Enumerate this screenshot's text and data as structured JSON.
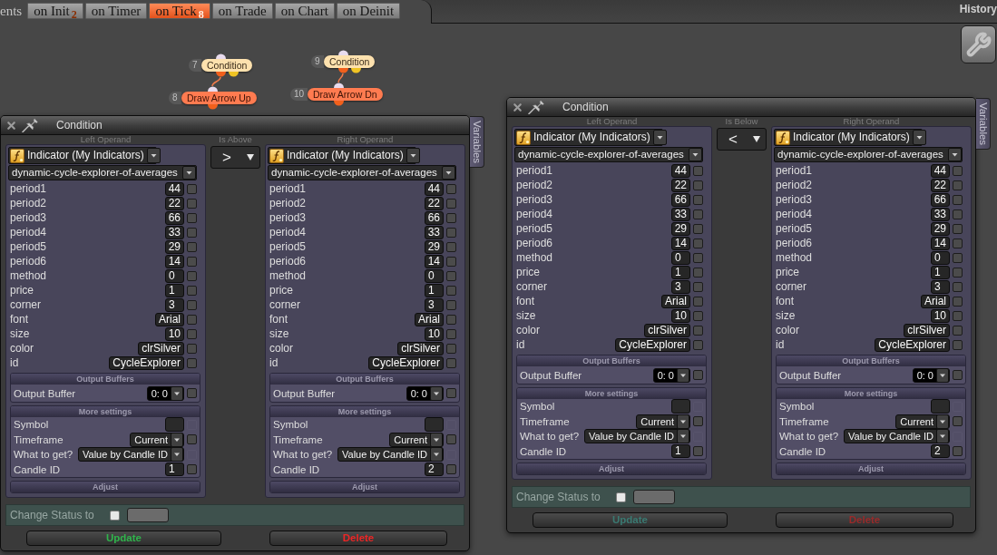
{
  "top_bar": {
    "partial_label": "ents",
    "tabs": [
      {
        "label": "on Init",
        "count": "2",
        "selected": false
      },
      {
        "label": "on Timer",
        "selected": false
      },
      {
        "label": "on Tick",
        "count": "8",
        "selected": true
      },
      {
        "label": "on Trade",
        "selected": false
      },
      {
        "label": "on Chart",
        "selected": false
      },
      {
        "label": "on Deinit",
        "selected": false
      }
    ],
    "history_label": "History"
  },
  "canvas": {
    "nodes": [
      {
        "number": "7",
        "label": "Condition",
        "kind": "condition",
        "children": [
          {
            "number": "8",
            "label": "Draw Arrow Up",
            "kind": "action"
          }
        ]
      },
      {
        "number": "9",
        "label": "Condition",
        "kind": "condition",
        "children": [
          {
            "number": "10",
            "label": "Draw Arrow Dn",
            "kind": "action"
          }
        ]
      }
    ]
  },
  "windows": [
    {
      "title": "Condition",
      "focused": true,
      "left_operand": {
        "heading": "Left Operand",
        "source": "Indicator (My Indicators)",
        "indicator": "dynamic-cycle-explorer-of-averages",
        "params": [
          {
            "name": "period1",
            "value": "44",
            "checked": false
          },
          {
            "name": "period2",
            "value": "22",
            "checked": false
          },
          {
            "name": "period3",
            "value": "66",
            "checked": false
          },
          {
            "name": "period4",
            "value": "33",
            "checked": false
          },
          {
            "name": "period5",
            "value": "29",
            "checked": false
          },
          {
            "name": "period6",
            "value": "14",
            "checked": false
          },
          {
            "name": "method",
            "value": "0",
            "checked": false
          },
          {
            "name": "price",
            "value": "1",
            "checked": false
          },
          {
            "name": "corner",
            "value": "3",
            "checked": false
          },
          {
            "name": "font",
            "value": "Arial",
            "checked": false
          },
          {
            "name": "size",
            "value": "10",
            "checked": false
          },
          {
            "name": "color",
            "value": "clrSilver",
            "checked": false
          },
          {
            "name": "id",
            "value": "CycleExplorer",
            "checked": false
          }
        ],
        "output_buffers": {
          "heading": "Output Buffers",
          "rows": [
            {
              "name": "Output Buffer",
              "value": "0: 0",
              "checked": false
            }
          ]
        },
        "more_settings": {
          "heading": "More settings",
          "rows": [
            {
              "name": "Symbol",
              "kind": "field",
              "checked": false,
              "disabled": true
            },
            {
              "name": "Timeframe",
              "kind": "select",
              "value": "Current",
              "checked": false,
              "disabled": false
            },
            {
              "name": "What to get?",
              "kind": "select",
              "value": "Value by Candle ID",
              "checked": false,
              "disabled": true
            },
            {
              "name": "Candle ID",
              "kind": "field",
              "value": "1",
              "checked": false,
              "disabled": false
            }
          ]
        },
        "adjust": {
          "heading": "Adjust"
        }
      },
      "operator": {
        "label": "Is Above",
        "value": ">"
      },
      "right_operand": {
        "heading": "Right Operand",
        "source": "Indicator (My Indicators)",
        "indicator": "dynamic-cycle-explorer-of-averages",
        "params": [
          {
            "name": "period1",
            "value": "44",
            "checked": false
          },
          {
            "name": "period2",
            "value": "22",
            "checked": false
          },
          {
            "name": "period3",
            "value": "66",
            "checked": false
          },
          {
            "name": "period4",
            "value": "33",
            "checked": false
          },
          {
            "name": "period5",
            "value": "29",
            "checked": false
          },
          {
            "name": "period6",
            "value": "14",
            "checked": false
          },
          {
            "name": "method",
            "value": "0",
            "checked": false
          },
          {
            "name": "price",
            "value": "1",
            "checked": false
          },
          {
            "name": "corner",
            "value": "3",
            "checked": false
          },
          {
            "name": "font",
            "value": "Arial",
            "checked": false
          },
          {
            "name": "size",
            "value": "10",
            "checked": false
          },
          {
            "name": "color",
            "value": "clrSilver",
            "checked": false
          },
          {
            "name": "id",
            "value": "CycleExplorer",
            "checked": false
          }
        ],
        "output_buffers": {
          "heading": "Output Buffers",
          "rows": [
            {
              "name": "Output Buffer",
              "value": "0: 0",
              "checked": false
            }
          ]
        },
        "more_settings": {
          "heading": "More settings",
          "rows": [
            {
              "name": "Symbol",
              "kind": "field",
              "checked": false,
              "disabled": true
            },
            {
              "name": "Timeframe",
              "kind": "select",
              "value": "Current",
              "checked": false,
              "disabled": false
            },
            {
              "name": "What to get?",
              "kind": "select",
              "value": "Value by Candle ID",
              "checked": false,
              "disabled": true
            },
            {
              "name": "Candle ID",
              "kind": "field",
              "value": "2",
              "checked": false,
              "disabled": false
            }
          ]
        },
        "adjust": {
          "heading": "Adjust"
        }
      },
      "status": {
        "label": "Change Status to",
        "checked": false
      },
      "buttons": [
        {
          "label": "Update",
          "kind": "update"
        },
        {
          "label": "Delete",
          "kind": "delete"
        }
      ],
      "side_tab": "Variables"
    },
    {
      "title": "Condition",
      "focused": false,
      "left_operand": {
        "heading": "Left Operand",
        "source": "Indicator (My Indicators)",
        "indicator": "dynamic-cycle-explorer-of-averages",
        "params": [
          {
            "name": "period1",
            "value": "44",
            "checked": false
          },
          {
            "name": "period2",
            "value": "22",
            "checked": false
          },
          {
            "name": "period3",
            "value": "66",
            "checked": false
          },
          {
            "name": "period4",
            "value": "33",
            "checked": false
          },
          {
            "name": "period5",
            "value": "29",
            "checked": false
          },
          {
            "name": "period6",
            "value": "14",
            "checked": false
          },
          {
            "name": "method",
            "value": "0",
            "checked": false
          },
          {
            "name": "price",
            "value": "1",
            "checked": false
          },
          {
            "name": "corner",
            "value": "3",
            "checked": false
          },
          {
            "name": "font",
            "value": "Arial",
            "checked": false
          },
          {
            "name": "size",
            "value": "10",
            "checked": false
          },
          {
            "name": "color",
            "value": "clrSilver",
            "checked": false
          },
          {
            "name": "id",
            "value": "CycleExplorer",
            "checked": false
          }
        ],
        "output_buffers": {
          "heading": "Output Buffers",
          "rows": [
            {
              "name": "Output Buffer",
              "value": "0: 0",
              "checked": false
            }
          ]
        },
        "more_settings": {
          "heading": "More settings",
          "rows": [
            {
              "name": "Symbol",
              "kind": "field",
              "checked": false,
              "disabled": true
            },
            {
              "name": "Timeframe",
              "kind": "select",
              "value": "Current",
              "checked": false,
              "disabled": false
            },
            {
              "name": "What to get?",
              "kind": "select",
              "value": "Value by Candle ID",
              "checked": false,
              "disabled": true
            },
            {
              "name": "Candle ID",
              "kind": "field",
              "value": "1",
              "checked": false,
              "disabled": false
            }
          ]
        },
        "adjust": {
          "heading": "Adjust"
        }
      },
      "operator": {
        "label": "Is Below",
        "value": "<"
      },
      "right_operand": {
        "heading": "Right Operand",
        "source": "Indicator (My Indicators)",
        "indicator": "dynamic-cycle-explorer-of-averages",
        "params": [
          {
            "name": "period1",
            "value": "44",
            "checked": false
          },
          {
            "name": "period2",
            "value": "22",
            "checked": false
          },
          {
            "name": "period3",
            "value": "66",
            "checked": false
          },
          {
            "name": "period4",
            "value": "33",
            "checked": false
          },
          {
            "name": "period5",
            "value": "29",
            "checked": false
          },
          {
            "name": "period6",
            "value": "14",
            "checked": false
          },
          {
            "name": "method",
            "value": "0",
            "checked": false
          },
          {
            "name": "price",
            "value": "1",
            "checked": false
          },
          {
            "name": "corner",
            "value": "3",
            "checked": false
          },
          {
            "name": "font",
            "value": "Arial",
            "checked": false
          },
          {
            "name": "size",
            "value": "10",
            "checked": false
          },
          {
            "name": "color",
            "value": "clrSilver",
            "checked": false
          },
          {
            "name": "id",
            "value": "CycleExplorer",
            "checked": false
          }
        ],
        "output_buffers": {
          "heading": "Output Buffers",
          "rows": [
            {
              "name": "Output Buffer",
              "value": "0: 0",
              "checked": false
            }
          ]
        },
        "more_settings": {
          "heading": "More settings",
          "rows": [
            {
              "name": "Symbol",
              "kind": "field",
              "checked": false,
              "disabled": true
            },
            {
              "name": "Timeframe",
              "kind": "select",
              "value": "Current",
              "checked": false,
              "disabled": false
            },
            {
              "name": "What to get?",
              "kind": "select",
              "value": "Value by Candle ID",
              "checked": false,
              "disabled": true
            },
            {
              "name": "Candle ID",
              "kind": "field",
              "value": "2",
              "checked": false,
              "disabled": false
            }
          ]
        },
        "adjust": {
          "heading": "Adjust"
        }
      },
      "status": {
        "label": "Change Status to",
        "checked": false
      },
      "buttons": [
        {
          "label": "Update",
          "kind": "update"
        },
        {
          "label": "Delete",
          "kind": "delete"
        }
      ],
      "side_tab": "Variables"
    }
  ]
}
